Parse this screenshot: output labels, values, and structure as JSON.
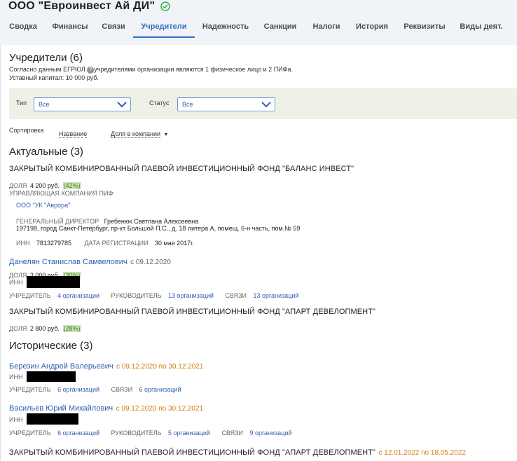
{
  "company": {
    "name": "ООО \"Евроинвест Ай ДИ\""
  },
  "tabs": [
    "Сводка",
    "Финансы",
    "Связи",
    "Учредители",
    "Надежность",
    "Санкции",
    "Налоги",
    "История",
    "Реквизиты",
    "Виды деят."
  ],
  "section": {
    "title": "Учредители (6)",
    "desc_prefix": "Согласно данным ЕГРЮЛ",
    "desc_suffix": "учредителями организации являются 1 физическое лицо и 2 ПИФа.",
    "capital": "Уставный капитал: 10 000 руб."
  },
  "filters": {
    "type_label": "Тип",
    "type_value": "Все",
    "status_label": "Статус",
    "status_value": "Все"
  },
  "sort": {
    "label": "Сортировка",
    "by_name": "Название",
    "by_share": "Доля в компании",
    "arrow": "▼"
  },
  "actual": {
    "title": "Актуальные (3)",
    "fund1": {
      "name": "ЗАКРЫТЫЙ КОМБИНИРОВАННЫЙ ПАЕВОЙ ИНВЕСТИЦИОННЫЙ ФОНД \"БАЛАНС ИНВЕСТ\"",
      "share_label": "ДОЛЯ",
      "share_value": "4 200 руб.",
      "share_pct": "(42%)",
      "mgmt_label": "УПРАВЛЯЮЩАЯ КОМПАНИЯ ПИФ:",
      "mgmt_name": "ООО \"УК \"Аврора\"",
      "director_label": "ГЕНЕРАЛЬНЫЙ ДИРЕКТОР",
      "director_value": "Гребенюк Светлана Алексеевна",
      "address": "197198, город Санкт-Петербург, пр-кт Большой П.С., д. 18 литера А, помещ. 6-н часть, пом.№ 59",
      "inn_label": "ИНН",
      "inn_value": "7813279785",
      "reg_label": "ДАТА РЕГИСТРАЦИИ",
      "reg_value": "30 мая 2017г."
    },
    "person1": {
      "name": "Данелян Станислав Самвелович",
      "since": "с 09.12.2020",
      "share_label": "ДОЛЯ",
      "share_value": "3 000 руб.",
      "share_pct": "(30%)",
      "inn_label": "ИНН",
      "founder_label": "УЧРЕДИТЕЛЬ",
      "founder_value": "4 организации",
      "head_label": "РУКОВОДИТЕЛЬ",
      "head_value": "13 организаций",
      "links_label": "СВЯЗИ",
      "links_value": "13 организаций"
    },
    "fund2": {
      "name": "ЗАКРЫТЫЙ КОМБИНИРОВАННЫЙ ПАЕВОЙ ИНВЕСТИЦИОННЫЙ ФОНД \"АПАРТ ДЕВЕЛОПМЕНТ\"",
      "share_label": "ДОЛЯ",
      "share_value": "2 800 руб.",
      "share_pct": "(28%)"
    }
  },
  "historic": {
    "title": "Исторические (3)",
    "p1": {
      "name": "Березин Андрей Валерьевич",
      "period": "с 09.12.2020 по 30.12.2021",
      "inn_label": "ИНН",
      "founder_label": "УЧРЕДИТЕЛЬ",
      "founder_value": "6 организаций",
      "links_label": "СВЯЗИ",
      "links_value": "6 организаций"
    },
    "p2": {
      "name": "Васильев Юрий Михайлович",
      "period": "с 09.12.2020 по 30.12.2021",
      "inn_label": "ИНН",
      "founder_label": "УЧРЕДИТЕЛЬ",
      "founder_value": "6 организаций",
      "head_label": "РУКОВОДИТЕЛЬ",
      "head_value": "5 организаций",
      "links_label": "СВЯЗИ",
      "links_value": "9 организаций"
    },
    "fund": {
      "name": "ЗАКРЫТЫЙ КОМБИНИРОВАННЫЙ ПАЕВОЙ ИНВЕСТИЦИОННЫЙ ФОНД \"АПАРТ ДЕВЕЛОПМЕНТ\"",
      "period": "с 12.01.2022 по 18.05.2022"
    }
  },
  "colors": {
    "accent": "#2f6fc6",
    "link": "#2f5fb5",
    "period": "#d47b0e",
    "pct_bg": "#cfe7b6"
  },
  "icons": {
    "verified": "check-circle-icon",
    "info": "info-icon",
    "dropdown": "chevron-down-icon"
  }
}
